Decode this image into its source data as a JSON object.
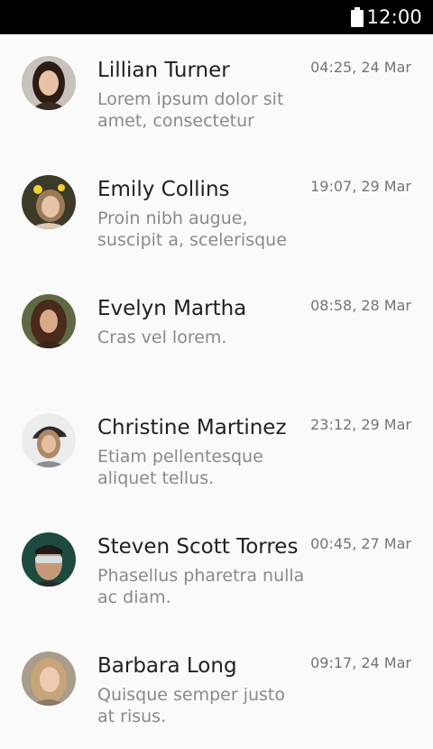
{
  "status_bar": {
    "time": "12:00",
    "battery_icon": "battery-full-icon"
  },
  "conversations": [
    {
      "name": "Lillian Turner",
      "time": "04:25, 24 Mar",
      "preview": "Lorem ipsum dolor sit amet, consectetur"
    },
    {
      "name": "Emily Collins",
      "time": "19:07, 29 Mar",
      "preview": "Proin nibh augue, suscipit a, scelerisque"
    },
    {
      "name": "Evelyn Martha",
      "time": "08:58, 28 Mar",
      "preview": "Cras vel lorem."
    },
    {
      "name": "Christine Martinez",
      "time": "23:12, 29 Mar",
      "preview": "Etiam pellentesque aliquet tellus."
    },
    {
      "name": "Steven Scott Torres",
      "time": "00:45, 27 Mar",
      "preview": "Phasellus pharetra nulla ac diam."
    },
    {
      "name": "Barbara Long",
      "time": "09:17, 24 Mar",
      "preview": "Quisque semper justo at risus."
    }
  ]
}
